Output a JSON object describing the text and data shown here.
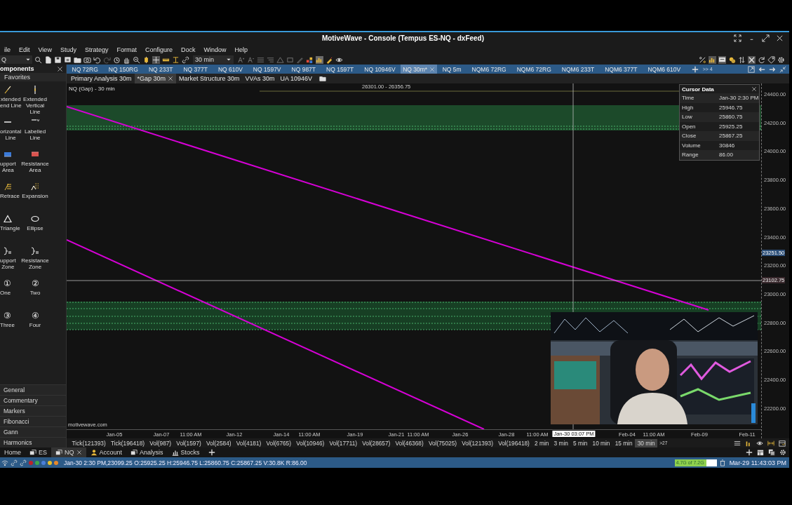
{
  "window": {
    "title": "MotiveWave - Console (Tempus ES-NQ - dxFeed)"
  },
  "menu": [
    "ile",
    "Edit",
    "View",
    "Study",
    "Strategy",
    "Format",
    "Configure",
    "Dock",
    "Window",
    "Help"
  ],
  "toolbar": {
    "symbol": "Q",
    "timeframe": "30 min"
  },
  "components_panel": {
    "title": "omponents",
    "section": "Favorites",
    "tools": [
      {
        "lines": [
          "xtended",
          "end Line"
        ]
      },
      {
        "lines": [
          "Extended",
          "Vertical",
          "Line"
        ]
      },
      {
        "lines": [
          "orizontal",
          "Line"
        ]
      },
      {
        "lines": [
          "Labelled",
          "Line"
        ]
      },
      {
        "lines": [
          "upport",
          "Area"
        ]
      },
      {
        "lines": [
          "Resistance",
          "Area"
        ]
      },
      {
        "lines": [
          "Retrace"
        ]
      },
      {
        "lines": [
          "Expansion"
        ]
      },
      {
        "lines": [
          "Triangle"
        ]
      },
      {
        "lines": [
          "Ellipse"
        ]
      },
      {
        "lines": [
          "upport",
          "Zone"
        ]
      },
      {
        "lines": [
          "Resistance",
          "Zone"
        ]
      },
      {
        "lines": [
          "One"
        ],
        "glyph": "①"
      },
      {
        "lines": [
          "Two"
        ],
        "glyph": "②"
      },
      {
        "lines": [
          "Three"
        ],
        "glyph": "③"
      },
      {
        "lines": [
          "Four"
        ],
        "glyph": "④"
      }
    ],
    "categories": [
      "General",
      "Commentary",
      "Markers",
      "Fibonacci",
      "Gann",
      "Harmonics"
    ]
  },
  "chart_tabs": [
    {
      "label": "NQ 72RG",
      "selected": false
    },
    {
      "label": "NQ 150RG",
      "selected": false
    },
    {
      "label": "NQ 233T",
      "selected": false
    },
    {
      "label": "NQ 377T",
      "selected": false
    },
    {
      "label": "NQ 610V",
      "selected": false
    },
    {
      "label": "NQ 1597V",
      "selected": false
    },
    {
      "label": "NQ 987T",
      "selected": false
    },
    {
      "label": "NQ 1597T",
      "selected": false
    },
    {
      "label": "NQ 10946V",
      "selected": false
    },
    {
      "label": "NQ 30m*",
      "selected": true
    },
    {
      "label": "NQ 5m",
      "selected": false
    },
    {
      "label": "NQM6 72RG",
      "selected": false
    },
    {
      "label": "NQM6 72RG",
      "selected": false
    },
    {
      "label": "NQM6 233T",
      "selected": false
    },
    {
      "label": "NQM6 377T",
      "selected": false
    },
    {
      "label": "NQM6 610V",
      "selected": false
    }
  ],
  "chart_tabs_more": ">> 4",
  "sub_tabs": [
    {
      "label": "Primary Analysis 30m",
      "selected": false
    },
    {
      "label": "*Gap 30m",
      "selected": true
    },
    {
      "label": "Market Structure 30m",
      "selected": false
    },
    {
      "label": "VVAs 30m",
      "selected": false
    },
    {
      "label": "UA 10946V",
      "selected": false
    }
  ],
  "chart": {
    "title": "NQ (Gap) - 30 min",
    "range_label": "26301.00 - 26356.75",
    "watermark": "motivewave.com",
    "y_axis_labels": [
      "24400.00",
      "24200.00",
      "24000.00",
      "23800.00",
      "23600.00",
      "23400.00",
      "23200.00",
      "23000.00",
      "22800.00",
      "22600.00",
      "22400.00",
      "22200.00"
    ],
    "price_tags": [
      "23251.50",
      "23102.75"
    ],
    "x_axis_labels": [
      "Jan-05",
      "Jan-07",
      "11:00 AM",
      "Jan-12",
      "Jan-14",
      "11:00 AM",
      "Jan-19",
      "Jan-21",
      "11:00 AM",
      "Jan-26",
      "Jan-28",
      "11:00 AM",
      "Feb-04",
      "11:00 AM",
      "Feb-09",
      "Feb-11"
    ],
    "cursor_time_label": "Jan-30 03:07 PM"
  },
  "cursor_data": {
    "title": "Cursor Data",
    "rows": [
      {
        "label": "Time",
        "value": "Jan-30 2:30 PM"
      },
      {
        "label": "High",
        "value": "25946.75"
      },
      {
        "label": "Low",
        "value": "25860.75"
      },
      {
        "label": "Open",
        "value": "25925.25"
      },
      {
        "label": "Close",
        "value": "25867.25"
      },
      {
        "label": "Volume",
        "value": "30846"
      },
      {
        "label": "Range",
        "value": "86.00"
      }
    ]
  },
  "bar_types": [
    {
      "label": "Tick(121393)",
      "selected": false
    },
    {
      "label": "Tick(196418)",
      "selected": false
    },
    {
      "label": "Vol(987)",
      "selected": false
    },
    {
      "label": "Vol(1597)",
      "selected": false
    },
    {
      "label": "Vol(2584)",
      "selected": false
    },
    {
      "label": "Vol(4181)",
      "selected": false
    },
    {
      "label": "Vol(6765)",
      "selected": false
    },
    {
      "label": "Vol(10946)",
      "selected": false
    },
    {
      "label": "Vol(17711)",
      "selected": false
    },
    {
      "label": "Vol(28657)",
      "selected": false
    },
    {
      "label": "Vol(46368)",
      "selected": false
    },
    {
      "label": "Vol(75025)",
      "selected": false
    },
    {
      "label": "Vol(121393)",
      "selected": false
    },
    {
      "label": "Vol(196418)",
      "selected": false
    },
    {
      "label": "2 min",
      "selected": false
    },
    {
      "label": "3 min",
      "selected": false
    },
    {
      "label": "5 min",
      "selected": false
    },
    {
      "label": "10 min",
      "selected": false
    },
    {
      "label": "15 min",
      "selected": false
    },
    {
      "label": "30 min",
      "selected": true
    }
  ],
  "bar_types_more": ">27",
  "bottom_tabs": [
    {
      "label": "Home",
      "selected": false
    },
    {
      "label": "ES",
      "selected": false
    },
    {
      "label": "NQ",
      "selected": true
    },
    {
      "label": "Account",
      "selected": false
    },
    {
      "label": "Analysis",
      "selected": false
    },
    {
      "label": "Stocks",
      "selected": false
    }
  ],
  "status_bar": {
    "indicators": [
      {
        "color": "#c0202a"
      },
      {
        "color": "#3ea84a"
      },
      {
        "color": "#4a7fd8"
      },
      {
        "color": "#e6c02a"
      },
      {
        "color": "#e8892a"
      }
    ],
    "text": "Jan-30 2:30 PM,23099.25 O:25925.25 H:25946.75 L:25860.75 C:25867.25 V:30.8K R:86.00",
    "memory": {
      "label": "4.7G of 7.2G",
      "level": 0.75
    },
    "time": "Mar-29 11:43:03 PM"
  }
}
